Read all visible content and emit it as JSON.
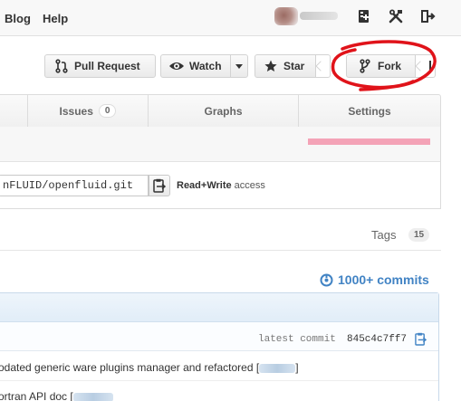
{
  "nav": {
    "links": [
      "Blog",
      "Help"
    ],
    "icons": [
      "create-repo-icon",
      "settings-icon",
      "sign-out-icon"
    ]
  },
  "actions": {
    "pull_request": "Pull Request",
    "watch": "Watch",
    "star": "Star",
    "fork": "Fork"
  },
  "tabs": [
    {
      "label": "Issues",
      "count": "0"
    },
    {
      "label": "Graphs"
    },
    {
      "label": "Settings"
    }
  ],
  "clone": {
    "url": "nFLUID/openfluid.git",
    "access_bold": "Read+Write",
    "access_rest": " access"
  },
  "tags": {
    "label": "Tags",
    "count": "15"
  },
  "commits": {
    "label": "1000+ commits",
    "latest_label": "latest commit",
    "sha": "845c4c7ff7"
  },
  "files": [
    {
      "message": "odated generic ware plugins manager and refactored [",
      "tail": "]"
    },
    {
      "message": "ortran API doc [",
      "tail": ""
    }
  ],
  "colors": {
    "accent": "#4183c4",
    "lang_bar": "#f4a3b7",
    "annotation": "#e0131a"
  }
}
